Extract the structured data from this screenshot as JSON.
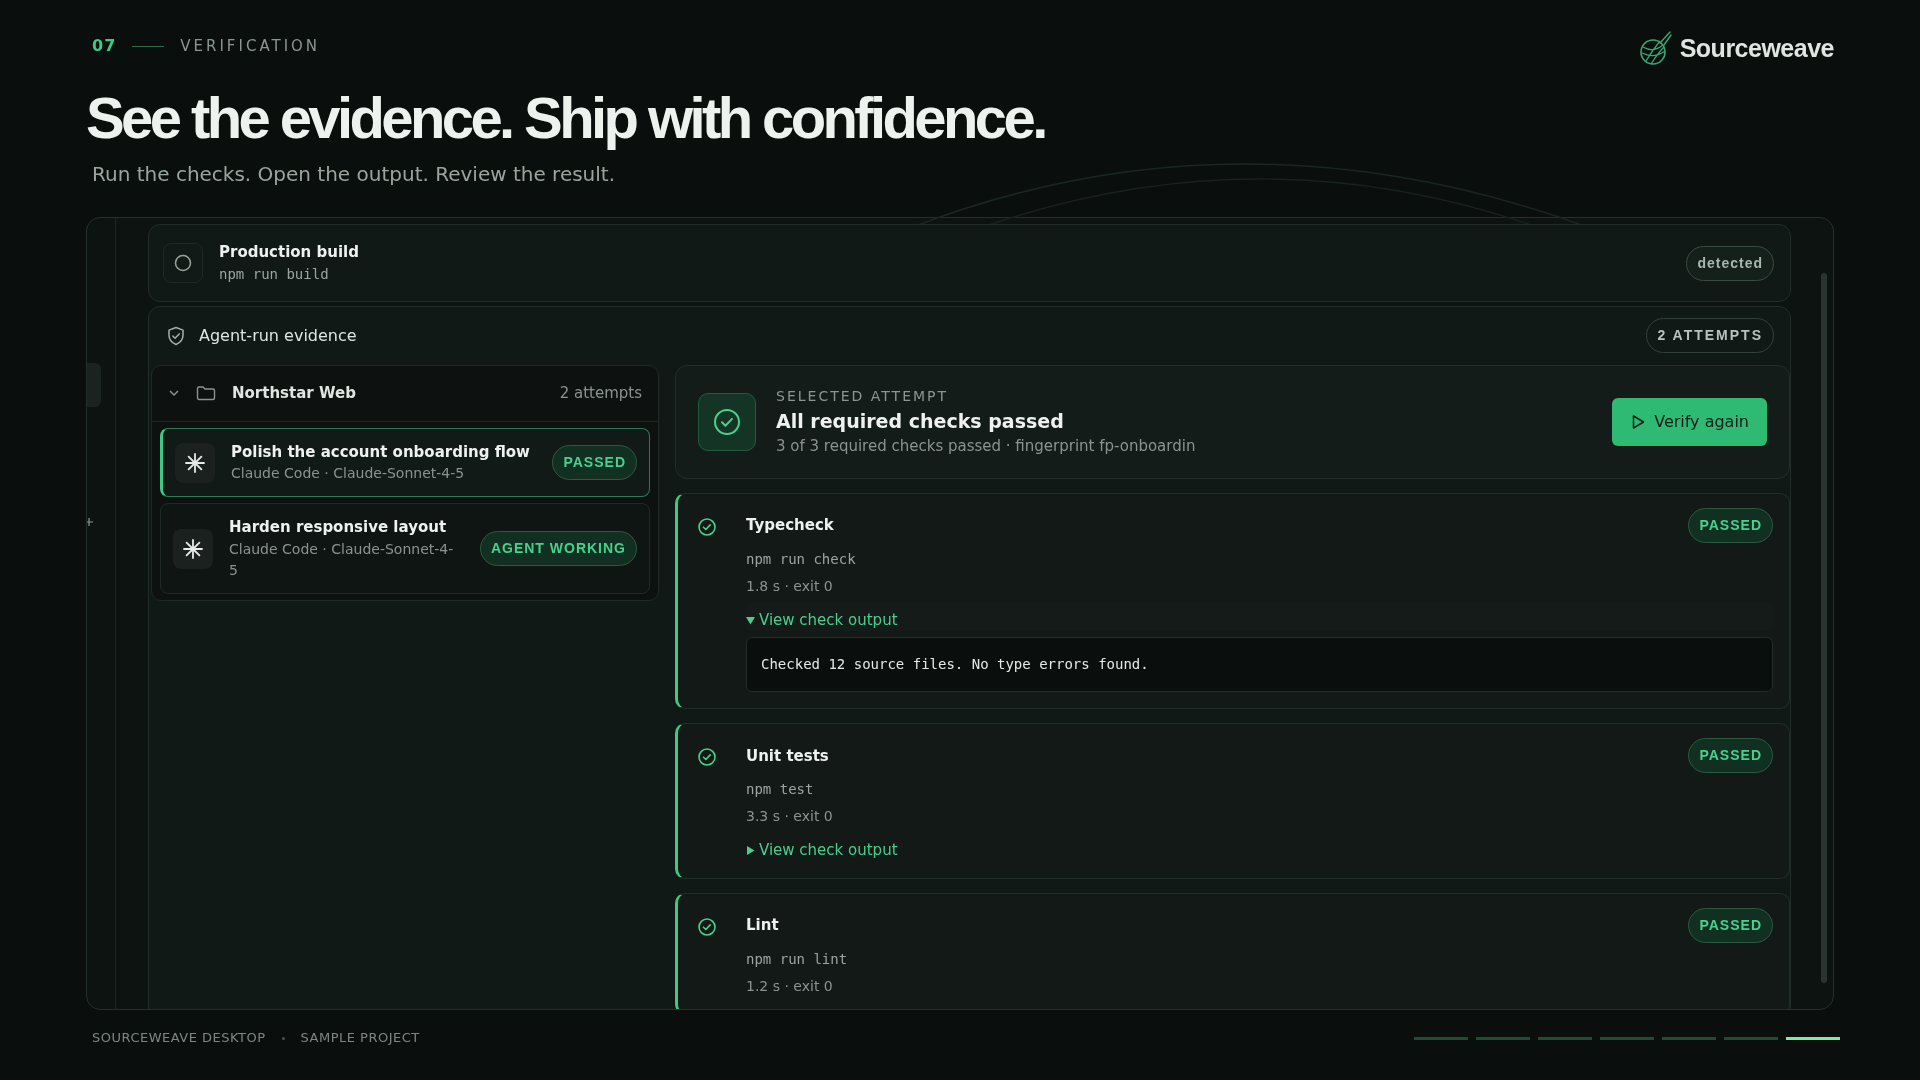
{
  "section": {
    "number": "07",
    "label": "VERIFICATION"
  },
  "brand": {
    "name": "Sourceweave"
  },
  "headline": "See the evidence. Ship with confidence.",
  "subtitle": "Run the checks. Open the output. Review the result.",
  "build_check": {
    "title": "Production build",
    "command": "npm run build",
    "status": "detected"
  },
  "evidence": {
    "title": "Agent-run evidence",
    "count": "2 ATTEMPTS",
    "project": {
      "name": "Northstar Web",
      "count": "2 attempts",
      "expanded": true
    },
    "attempts": [
      {
        "title": "Polish the account onboarding flow",
        "agent": "Claude Code · Claude-Sonnet-4-5",
        "status": "PASSED",
        "selected": true
      },
      {
        "title": "Harden responsive layout",
        "agent": "Claude Code · Claude-Sonnet-4-5",
        "status": "AGENT WORKING",
        "selected": false
      }
    ],
    "selected_attempt": {
      "eyebrow": "SELECTED ATTEMPT",
      "title": "All required checks passed",
      "summary": "3 of 3 required checks passed · fingerprint fp-onboardin",
      "action": "Verify again"
    },
    "checks": [
      {
        "name": "Typecheck",
        "command": "npm run check",
        "meta": "1.8 s · exit 0",
        "status": "PASSED",
        "toggle": "View check output",
        "expanded": true,
        "output": "Checked 12 source files. No type errors found."
      },
      {
        "name": "Unit tests",
        "command": "npm test",
        "meta": "3.3 s · exit 0",
        "status": "PASSED",
        "toggle": "View check output",
        "expanded": false
      },
      {
        "name": "Lint",
        "command": "npm run lint",
        "meta": "1.2 s · exit 0",
        "status": "PASSED"
      }
    ]
  },
  "footer": {
    "items": [
      "SOURCEWEAVE DESKTOP",
      "SAMPLE PROJECT"
    ]
  },
  "pager": [
    {
      "selected": false
    },
    {
      "selected": false
    },
    {
      "selected": false
    },
    {
      "selected": false
    },
    {
      "selected": false
    },
    {
      "selected": false
    },
    {
      "selected": true
    }
  ]
}
